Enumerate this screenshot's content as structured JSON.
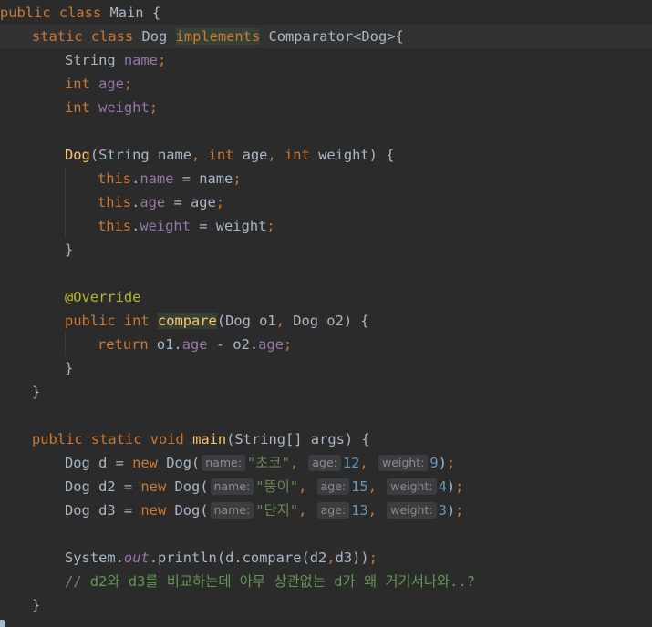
{
  "editor": {
    "lines": [
      {
        "tokens": [
          {
            "t": "public class ",
            "c": "kw"
          },
          {
            "t": "Main ",
            "c": "plain"
          },
          {
            "t": "{",
            "c": "plain"
          }
        ]
      },
      {
        "tokens": [
          {
            "t": "static class ",
            "c": "kw"
          },
          {
            "t": "Dog ",
            "c": "plain"
          },
          {
            "t": "implements",
            "c": "kw hl"
          },
          {
            "t": " Comparator<Dog>{",
            "c": "plain"
          }
        ]
      },
      {
        "tokens": [
          {
            "t": "String ",
            "c": "plain"
          },
          {
            "t": "name",
            "c": "field"
          },
          {
            "t": ";",
            "c": "kw"
          }
        ]
      },
      {
        "tokens": [
          {
            "t": "int ",
            "c": "kw"
          },
          {
            "t": "age",
            "c": "field"
          },
          {
            "t": ";",
            "c": "kw"
          }
        ]
      },
      {
        "tokens": [
          {
            "t": "int ",
            "c": "kw"
          },
          {
            "t": "weight",
            "c": "field"
          },
          {
            "t": ";",
            "c": "kw"
          }
        ]
      },
      {
        "tokens": []
      },
      {
        "tokens": [
          {
            "t": "Dog",
            "c": "fn"
          },
          {
            "t": "(String name",
            "c": "plain"
          },
          {
            "t": ", ",
            "c": "kw"
          },
          {
            "t": "int ",
            "c": "kw"
          },
          {
            "t": "age",
            "c": "plain"
          },
          {
            "t": ", ",
            "c": "kw"
          },
          {
            "t": "int ",
            "c": "kw"
          },
          {
            "t": "weight) {",
            "c": "plain"
          }
        ]
      },
      {
        "tokens": [
          {
            "t": "this",
            "c": "kw"
          },
          {
            "t": ".",
            "c": "plain"
          },
          {
            "t": "name",
            "c": "field"
          },
          {
            "t": " = name",
            "c": "plain"
          },
          {
            "t": ";",
            "c": "kw"
          }
        ]
      },
      {
        "tokens": [
          {
            "t": "this",
            "c": "kw"
          },
          {
            "t": ".",
            "c": "plain"
          },
          {
            "t": "age",
            "c": "field"
          },
          {
            "t": " = age",
            "c": "plain"
          },
          {
            "t": ";",
            "c": "kw"
          }
        ]
      },
      {
        "tokens": [
          {
            "t": "this",
            "c": "kw"
          },
          {
            "t": ".",
            "c": "plain"
          },
          {
            "t": "weight",
            "c": "field"
          },
          {
            "t": " = weight",
            "c": "plain"
          },
          {
            "t": ";",
            "c": "kw"
          }
        ]
      },
      {
        "tokens": [
          {
            "t": "}",
            "c": "plain"
          }
        ]
      },
      {
        "tokens": []
      },
      {
        "tokens": [
          {
            "t": "@Override",
            "c": "ann"
          }
        ]
      },
      {
        "tokens": [
          {
            "t": "public int ",
            "c": "kw"
          },
          {
            "t": "compare",
            "c": "fn hl"
          },
          {
            "t": "(Dog o1",
            "c": "plain"
          },
          {
            "t": ", ",
            "c": "kw"
          },
          {
            "t": "Dog o2) {",
            "c": "plain"
          }
        ]
      },
      {
        "tokens": [
          {
            "t": "return ",
            "c": "kw"
          },
          {
            "t": "o1.",
            "c": "plain"
          },
          {
            "t": "age",
            "c": "field"
          },
          {
            "t": " - o2.",
            "c": "plain"
          },
          {
            "t": "age",
            "c": "field"
          },
          {
            "t": ";",
            "c": "kw"
          }
        ]
      },
      {
        "tokens": [
          {
            "t": "}",
            "c": "plain"
          }
        ]
      },
      {
        "tokens": [
          {
            "t": "}",
            "c": "plain"
          }
        ]
      },
      {
        "tokens": []
      },
      {
        "tokens": [
          {
            "t": "public static void ",
            "c": "kw"
          },
          {
            "t": "main",
            "c": "fn"
          },
          {
            "t": "(String[] args) {",
            "c": "plain"
          }
        ]
      },
      {
        "tokens": [
          {
            "t": "Dog d = ",
            "c": "plain"
          },
          {
            "t": "new ",
            "c": "kw"
          },
          {
            "t": "Dog(",
            "c": "plain"
          },
          {
            "t": "name:",
            "c": "hint"
          },
          {
            "t": "\"초코\"",
            "c": "str"
          },
          {
            "t": ", ",
            "c": "kw"
          },
          {
            "t": "age:",
            "c": "hint"
          },
          {
            "t": "12",
            "c": "num"
          },
          {
            "t": ", ",
            "c": "kw"
          },
          {
            "t": "weight:",
            "c": "hint"
          },
          {
            "t": "9",
            "c": "num"
          },
          {
            "t": ")",
            "c": "plain"
          },
          {
            "t": ";",
            "c": "kw"
          }
        ]
      },
      {
        "tokens": [
          {
            "t": "Dog d2 = ",
            "c": "plain"
          },
          {
            "t": "new ",
            "c": "kw"
          },
          {
            "t": "Dog(",
            "c": "plain"
          },
          {
            "t": "name:",
            "c": "hint"
          },
          {
            "t": "\"뚱이\"",
            "c": "str"
          },
          {
            "t": ", ",
            "c": "kw"
          },
          {
            "t": "age:",
            "c": "hint"
          },
          {
            "t": "15",
            "c": "num"
          },
          {
            "t": ", ",
            "c": "kw"
          },
          {
            "t": "weight:",
            "c": "hint"
          },
          {
            "t": "4",
            "c": "num"
          },
          {
            "t": ")",
            "c": "plain"
          },
          {
            "t": ";",
            "c": "kw"
          }
        ]
      },
      {
        "tokens": [
          {
            "t": "Dog d3 = ",
            "c": "plain"
          },
          {
            "t": "new ",
            "c": "kw"
          },
          {
            "t": "Dog(",
            "c": "plain"
          },
          {
            "t": "name:",
            "c": "hint"
          },
          {
            "t": "\"단지\"",
            "c": "str"
          },
          {
            "t": ", ",
            "c": "kw"
          },
          {
            "t": "age:",
            "c": "hint"
          },
          {
            "t": "13",
            "c": "num"
          },
          {
            "t": ", ",
            "c": "kw"
          },
          {
            "t": "weight:",
            "c": "hint"
          },
          {
            "t": "3",
            "c": "num"
          },
          {
            "t": ")",
            "c": "plain"
          },
          {
            "t": ";",
            "c": "kw"
          }
        ]
      },
      {
        "tokens": []
      },
      {
        "tokens": [
          {
            "t": "System.",
            "c": "plain"
          },
          {
            "t": "out",
            "c": "stat"
          },
          {
            "t": ".println(d.compare(d2",
            "c": "plain"
          },
          {
            "t": ",",
            "c": "kw"
          },
          {
            "t": "d3))",
            "c": "plain"
          },
          {
            "t": ";",
            "c": "kw"
          }
        ]
      },
      {
        "tokens": [
          {
            "t": "// d2와 d3를 비교하는데 아무 상관없는 d가 왜 거기서나와..?",
            "c": "cmt"
          }
        ]
      },
      {
        "tokens": [
          {
            "t": "}",
            "c": "plain"
          }
        ]
      }
    ]
  }
}
